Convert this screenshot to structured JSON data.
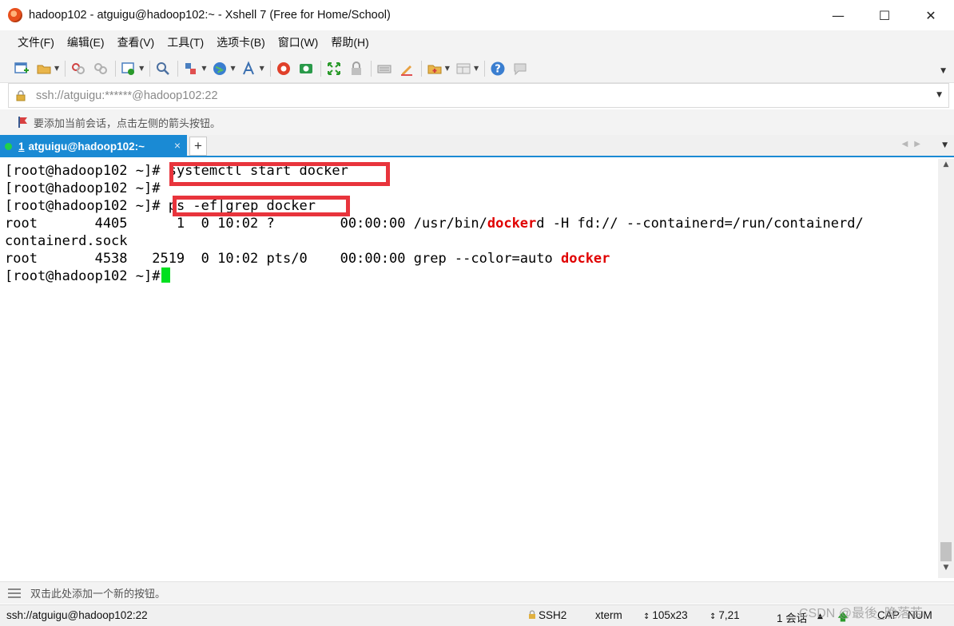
{
  "window": {
    "title": "hadoop102 - atguigu@hadoop102:~ - Xshell 7 (Free for Home/School)",
    "minimize": "—",
    "maximize": "☐",
    "close": "✕"
  },
  "menu": {
    "items": [
      "文件(F)",
      "编辑(E)",
      "查看(V)",
      "工具(T)",
      "选项卡(B)",
      "窗口(W)",
      "帮助(H)"
    ]
  },
  "address": {
    "value": "ssh://atguigu:******@hadoop102:22"
  },
  "hint_bar": {
    "text": "要添加当前会话，点击左侧的箭头按钮。"
  },
  "tabs": [
    {
      "number": "1",
      "label": "atguigu@hadoop102:~",
      "active": true
    }
  ],
  "terminal": {
    "prompt": "[root@hadoop102 ~]#",
    "command_1": " systemctl start docker",
    "command_2": "ps -ef|grep docker",
    "ps_row_1_prefix": "root       4405      1  0 10:02 ?        00:00:00 /usr/bin/",
    "ps_row_1_highlight": "docker",
    "ps_row_1_suffix": "d -H fd:// --containerd=/run/containerd/",
    "ps_row_1_wrap": "containerd.sock",
    "ps_row_2_prefix": "root       4538   2519  0 10:02 pts/0    00:00:00 grep --color=auto ",
    "ps_row_2_highlight": "docker",
    "cursor_color": "#00e020",
    "highlight_color": "#e00000",
    "annotation_box_color": "#e8343c"
  },
  "quick_bar": {
    "text": "双击此处添加一个新的按钮。"
  },
  "status": {
    "connection": "ssh://atguigu@hadoop102:22",
    "protocol": "SSH2",
    "terminal_type": "xterm",
    "size": "105x23",
    "position": "7,21",
    "sessions": "1 会话",
    "cap": "CAP",
    "num": "NUM"
  },
  "watermark": "CSDN @最後_晚落苦",
  "icons": [
    "new-session-icon",
    "open-folder-icon",
    "reconnect-icon",
    "disconnect-icon",
    "properties-icon",
    "find-icon",
    "transfer-icon",
    "globe-icon",
    "font-icon",
    "xshell-icon",
    "xftp-icon",
    "fullscreen-icon",
    "lock-icon",
    "keyboard-icon",
    "highlight-icon",
    "new-folder-icon",
    "layout-icon",
    "help-icon",
    "chat-icon"
  ]
}
